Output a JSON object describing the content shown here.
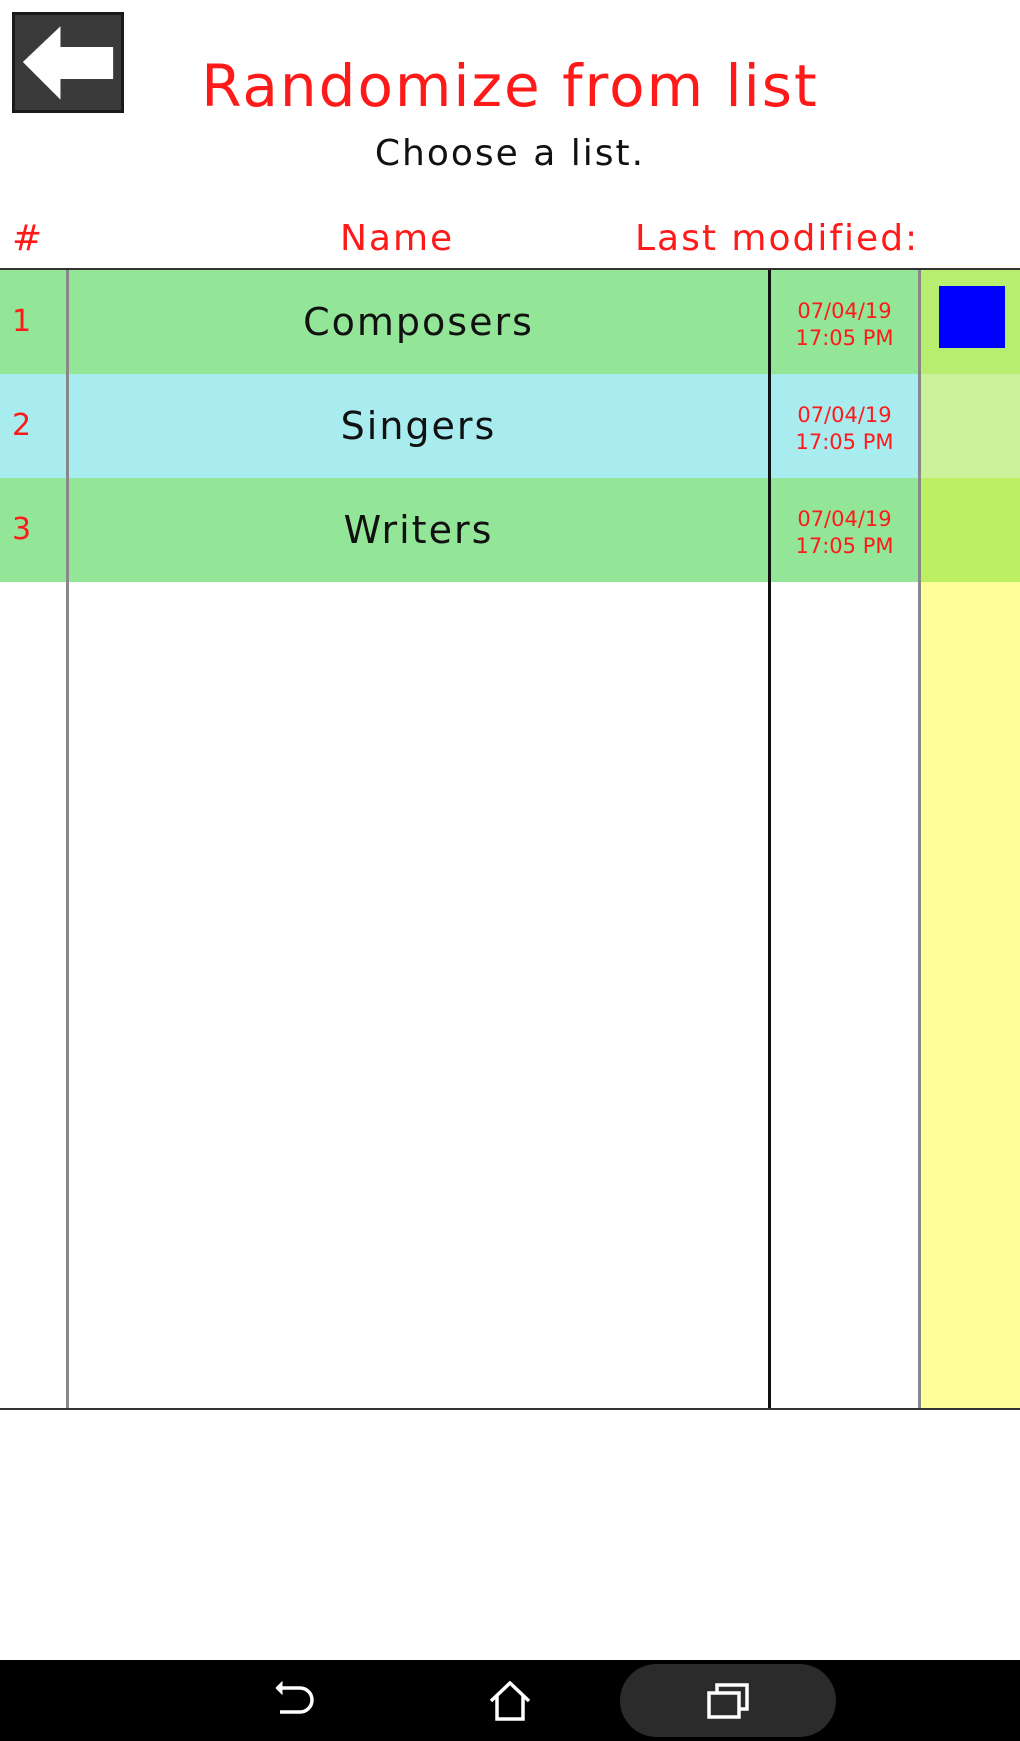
{
  "header": {
    "title": "Randomize from list",
    "subtitle": "Choose a list.",
    "back_icon": "back-arrow-icon"
  },
  "columns": {
    "number": "#",
    "name": "Name",
    "last_modified": "Last modified:"
  },
  "rows": [
    {
      "number": "1",
      "name": "Composers",
      "date": "07/04/19",
      "time": "17:05 PM"
    },
    {
      "number": "2",
      "name": "Singers",
      "date": "07/04/19",
      "time": "17:05 PM"
    },
    {
      "number": "3",
      "name": "Writers",
      "date": "07/04/19",
      "time": "17:05 PM"
    }
  ],
  "colors": {
    "accent": "#ff1a1a",
    "row_green": "#93e697",
    "row_blue": "#a8ecf0",
    "side_yellow": "#ffff99",
    "selector_blue": "#0000ff"
  },
  "navbar": {
    "icons": [
      "back-icon",
      "home-icon",
      "recent-apps-icon"
    ]
  }
}
